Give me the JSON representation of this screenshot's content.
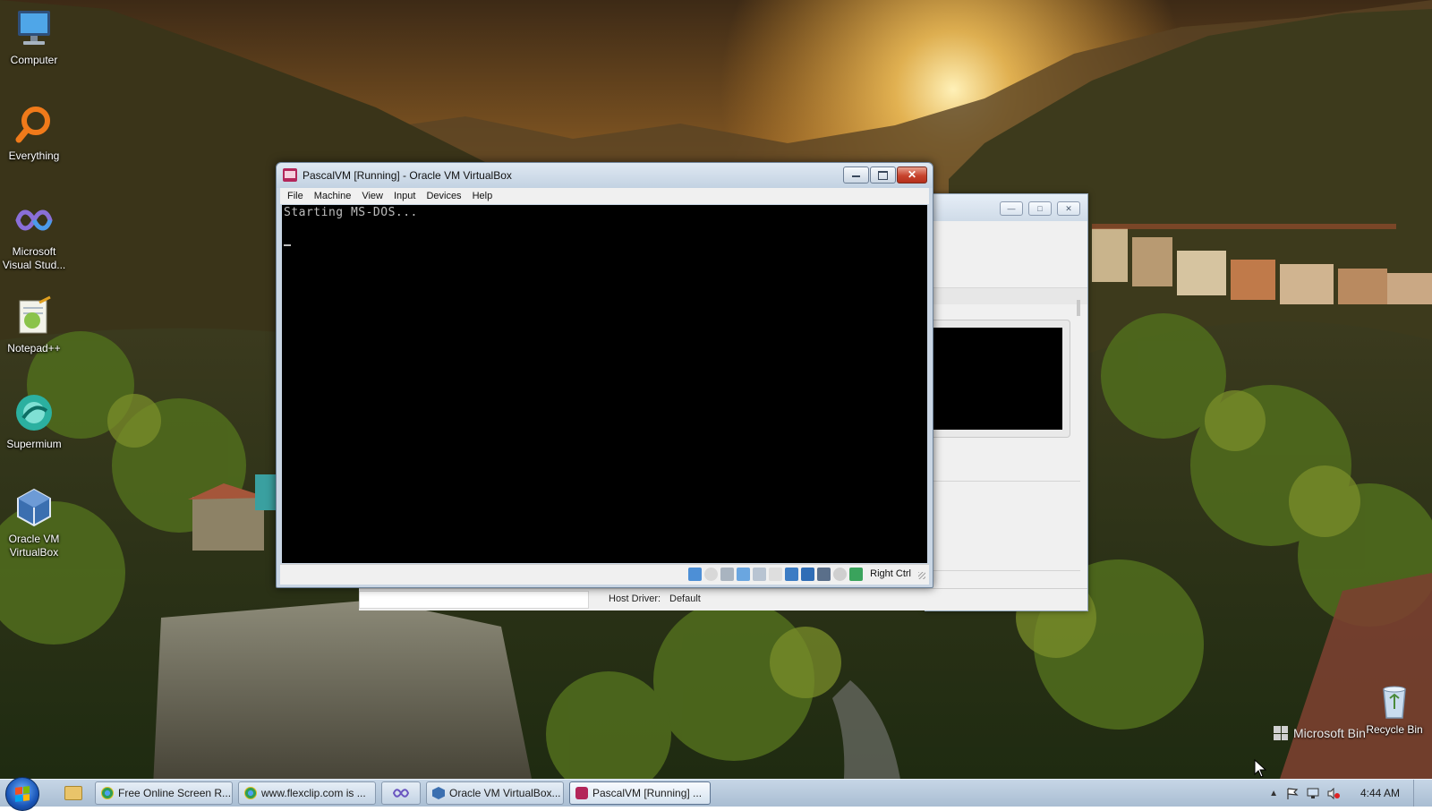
{
  "desktop": {
    "icons": [
      {
        "label": "Computer",
        "icon": "computer-icon"
      },
      {
        "label": "Everything",
        "icon": "everything-search-icon"
      },
      {
        "label": "Microsoft Visual Stud...",
        "icon": "visual-studio-icon"
      },
      {
        "label": "Notepad++",
        "icon": "notepadpp-icon"
      },
      {
        "label": "Supermium",
        "icon": "supermium-browser-icon"
      },
      {
        "label": "Oracle VM VirtualBox",
        "icon": "virtualbox-icon"
      },
      {
        "label": "Recycle Bin",
        "icon": "recycle-bin-icon"
      }
    ],
    "watermark": "Microsoft Bin"
  },
  "vm_window": {
    "title": "PascalVM [Running] - Oracle VM VirtualBox",
    "menu": [
      "File",
      "Machine",
      "View",
      "Input",
      "Devices",
      "Help"
    ],
    "screen_text": "Starting MS-DOS...",
    "host_key": "Right Ctrl",
    "status_icons": [
      "hard-disk-icon",
      "optical-drive-icon",
      "floppy-icon",
      "audio-icon",
      "network-icon",
      "usb-icon",
      "shared-folders-icon",
      "display-icon",
      "video-capture-icon",
      "cpu-icon",
      "mouse-integration-icon",
      "keyboard-capture-icon"
    ]
  },
  "background_window": {
    "host_driver_label": "Host Driver:",
    "host_driver_value": "Default"
  },
  "taskbar": {
    "buttons": [
      {
        "label": "Free Online Screen R...",
        "icon": "chrome-icon"
      },
      {
        "label": "www.flexclip.com is ...",
        "icon": "chrome-icon"
      },
      {
        "label": "",
        "icon": "visual-studio-icon"
      },
      {
        "label": "Oracle VM VirtualBox...",
        "icon": "virtualbox-icon"
      },
      {
        "label": "PascalVM [Running] ...",
        "icon": "dos-icon",
        "active": true
      }
    ],
    "clock": "4:44 AM"
  },
  "colors": {
    "taskbar": "#b9cbdf",
    "vm_screen": "#000000",
    "close_button": "#c7432d"
  }
}
